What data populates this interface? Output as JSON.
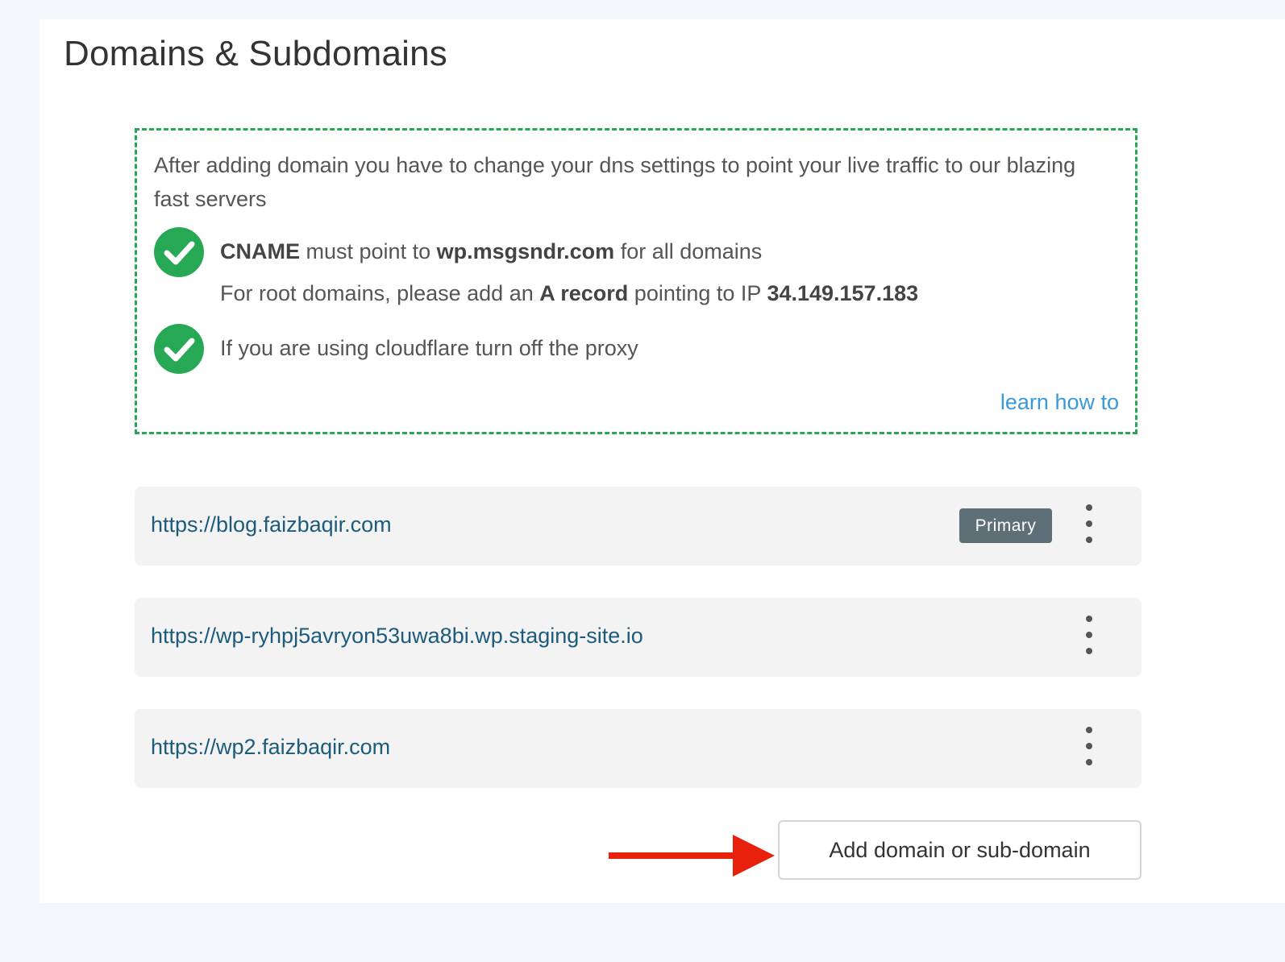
{
  "page": {
    "title": "Domains & Subdomains"
  },
  "notice": {
    "intro": "After adding domain you have to change your dns settings to point your live traffic to our blazing fast servers",
    "cname": {
      "label": "CNAME",
      "text_middle": "must point to",
      "target": "wp.msgsndr.com",
      "text_end": "for all domains"
    },
    "a_record": {
      "text_start": "For root domains, please add an",
      "label": "A record",
      "text_middle": "pointing to IP",
      "ip": "34.149.157.183"
    },
    "cloudflare": "If you are using cloudflare turn off the proxy",
    "learn_link": "learn how to",
    "icons": [
      "check-circle-icon",
      "check-circle-icon"
    ],
    "accent_color": "#27a855"
  },
  "domains": [
    {
      "url": "https://blog.faizbaqir.com",
      "badge": "Primary"
    },
    {
      "url": "https://wp-ryhpj5avryon53uwa8bi.wp.staging-site.io"
    },
    {
      "url": "https://wp2.faizbaqir.com"
    }
  ],
  "actions": {
    "add_label": "Add domain or sub-domain",
    "row_menu_icon": "kebab-menu-icon",
    "annotation_icon": "red-arrow-icon",
    "annotation_color": "#e8210c"
  }
}
